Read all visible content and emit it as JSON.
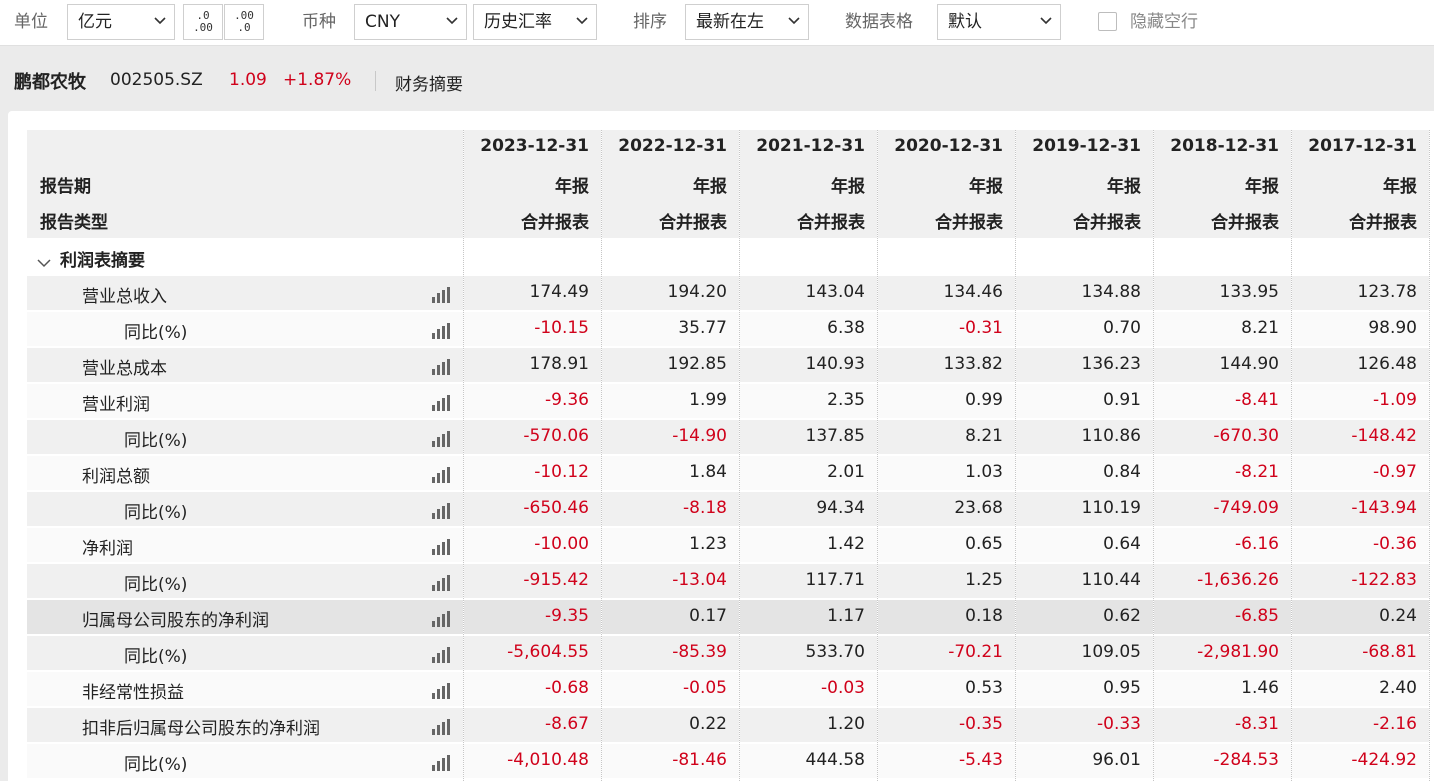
{
  "toolbar": {
    "unit_label": "单位",
    "unit_value": "亿元",
    "decimal_more": ".0 .00",
    "decimal_less": ".00 .0",
    "currency_label": "币种",
    "currency_value": "CNY",
    "rate_value": "历史汇率",
    "sort_label": "排序",
    "sort_value": "最新在左",
    "table_label": "数据表格",
    "table_value": "默认",
    "hide_empty_label": "隐藏空行"
  },
  "stock": {
    "name": "鹏都农牧",
    "code": "002505.SZ",
    "price": "1.09",
    "change": "+1.87%",
    "tab": "财务摘要"
  },
  "table": {
    "header_labels": [
      "报告期",
      "报告类型"
    ],
    "columns": [
      {
        "date": "2023-12-31",
        "period": "年报",
        "type": "合并报表"
      },
      {
        "date": "2022-12-31",
        "period": "年报",
        "type": "合并报表"
      },
      {
        "date": "2021-12-31",
        "period": "年报",
        "type": "合并报表"
      },
      {
        "date": "2020-12-31",
        "period": "年报",
        "type": "合并报表"
      },
      {
        "date": "2019-12-31",
        "period": "年报",
        "type": "合并报表"
      },
      {
        "date": "2018-12-31",
        "period": "年报",
        "type": "合并报表"
      },
      {
        "date": "2017-12-31",
        "period": "年报",
        "type": "合并报表"
      }
    ],
    "section_title": "利润表摘要",
    "rows": [
      {
        "label": "营业总收入",
        "level": 1,
        "values": [
          "174.49",
          "194.20",
          "143.04",
          "134.46",
          "134.88",
          "133.95",
          "123.78"
        ]
      },
      {
        "label": "同比(%)",
        "level": 2,
        "values": [
          "-10.15",
          "35.77",
          "6.38",
          "-0.31",
          "0.70",
          "8.21",
          "98.90"
        ]
      },
      {
        "label": "营业总成本",
        "level": 1,
        "values": [
          "178.91",
          "192.85",
          "140.93",
          "133.82",
          "136.23",
          "144.90",
          "126.48"
        ]
      },
      {
        "label": "营业利润",
        "level": 1,
        "values": [
          "-9.36",
          "1.99",
          "2.35",
          "0.99",
          "0.91",
          "-8.41",
          "-1.09"
        ]
      },
      {
        "label": "同比(%)",
        "level": 2,
        "values": [
          "-570.06",
          "-14.90",
          "137.85",
          "8.21",
          "110.86",
          "-670.30",
          "-148.42"
        ]
      },
      {
        "label": "利润总额",
        "level": 1,
        "values": [
          "-10.12",
          "1.84",
          "2.01",
          "1.03",
          "0.84",
          "-8.21",
          "-0.97"
        ]
      },
      {
        "label": "同比(%)",
        "level": 2,
        "values": [
          "-650.46",
          "-8.18",
          "94.34",
          "23.68",
          "110.19",
          "-749.09",
          "-143.94"
        ]
      },
      {
        "label": "净利润",
        "level": 1,
        "values": [
          "-10.00",
          "1.23",
          "1.42",
          "0.65",
          "0.64",
          "-6.16",
          "-0.36"
        ]
      },
      {
        "label": "同比(%)",
        "level": 2,
        "values": [
          "-915.42",
          "-13.04",
          "117.71",
          "1.25",
          "110.44",
          "-1,636.26",
          "-122.83"
        ]
      },
      {
        "label": "归属母公司股东的净利润",
        "level": 1,
        "highlight": true,
        "values": [
          "-9.35",
          "0.17",
          "1.17",
          "0.18",
          "0.62",
          "-6.85",
          "0.24"
        ]
      },
      {
        "label": "同比(%)",
        "level": 2,
        "values": [
          "-5,604.55",
          "-85.39",
          "533.70",
          "-70.21",
          "109.05",
          "-2,981.90",
          "-68.81"
        ]
      },
      {
        "label": "非经常性损益",
        "level": 1,
        "values": [
          "-0.68",
          "-0.05",
          "-0.03",
          "0.53",
          "0.95",
          "1.46",
          "2.40"
        ]
      },
      {
        "label": "扣非后归属母公司股东的净利润",
        "level": 1,
        "values": [
          "-8.67",
          "0.22",
          "1.20",
          "-0.35",
          "-0.33",
          "-8.31",
          "-2.16"
        ]
      },
      {
        "label": "同比(%)",
        "level": 2,
        "values": [
          "-4,010.48",
          "-81.46",
          "444.58",
          "-5.43",
          "96.01",
          "-284.53",
          "-424.92"
        ]
      }
    ]
  },
  "colors": {
    "negative": "#d0021b",
    "positive": "#222222"
  },
  "icons": {
    "row_chart": "bar-chart-icon",
    "dropdown": "chevron-down-icon",
    "section": "collapse-caret-icon"
  }
}
